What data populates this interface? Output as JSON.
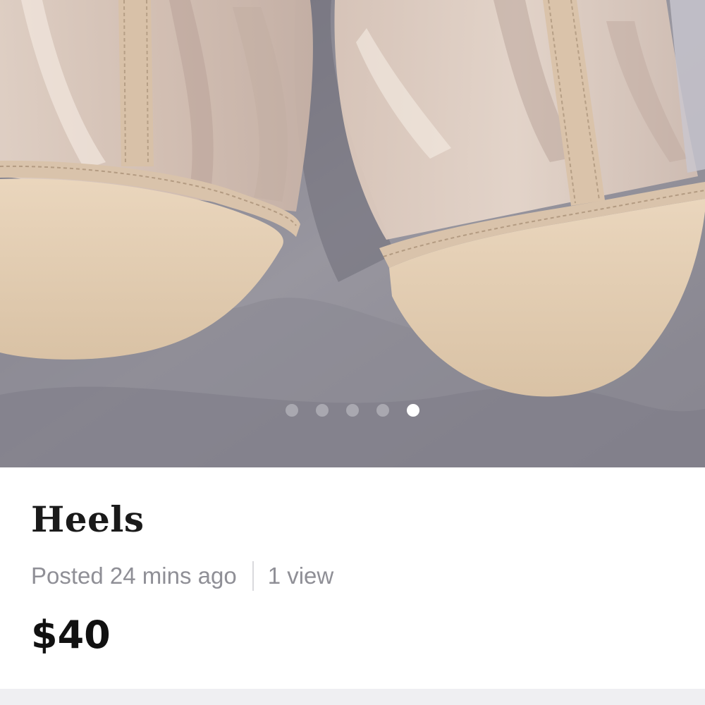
{
  "listing": {
    "title": "Heels",
    "posted": "Posted 24 mins ago",
    "views": "1 view",
    "price": "$40"
  },
  "carousel": {
    "image_count": 5,
    "active_index": 4
  },
  "colors": {
    "text_primary": "#111111",
    "text_secondary": "#8f8f96",
    "dot_active": "#ffffff",
    "dot_inactive": "#afafb6"
  }
}
